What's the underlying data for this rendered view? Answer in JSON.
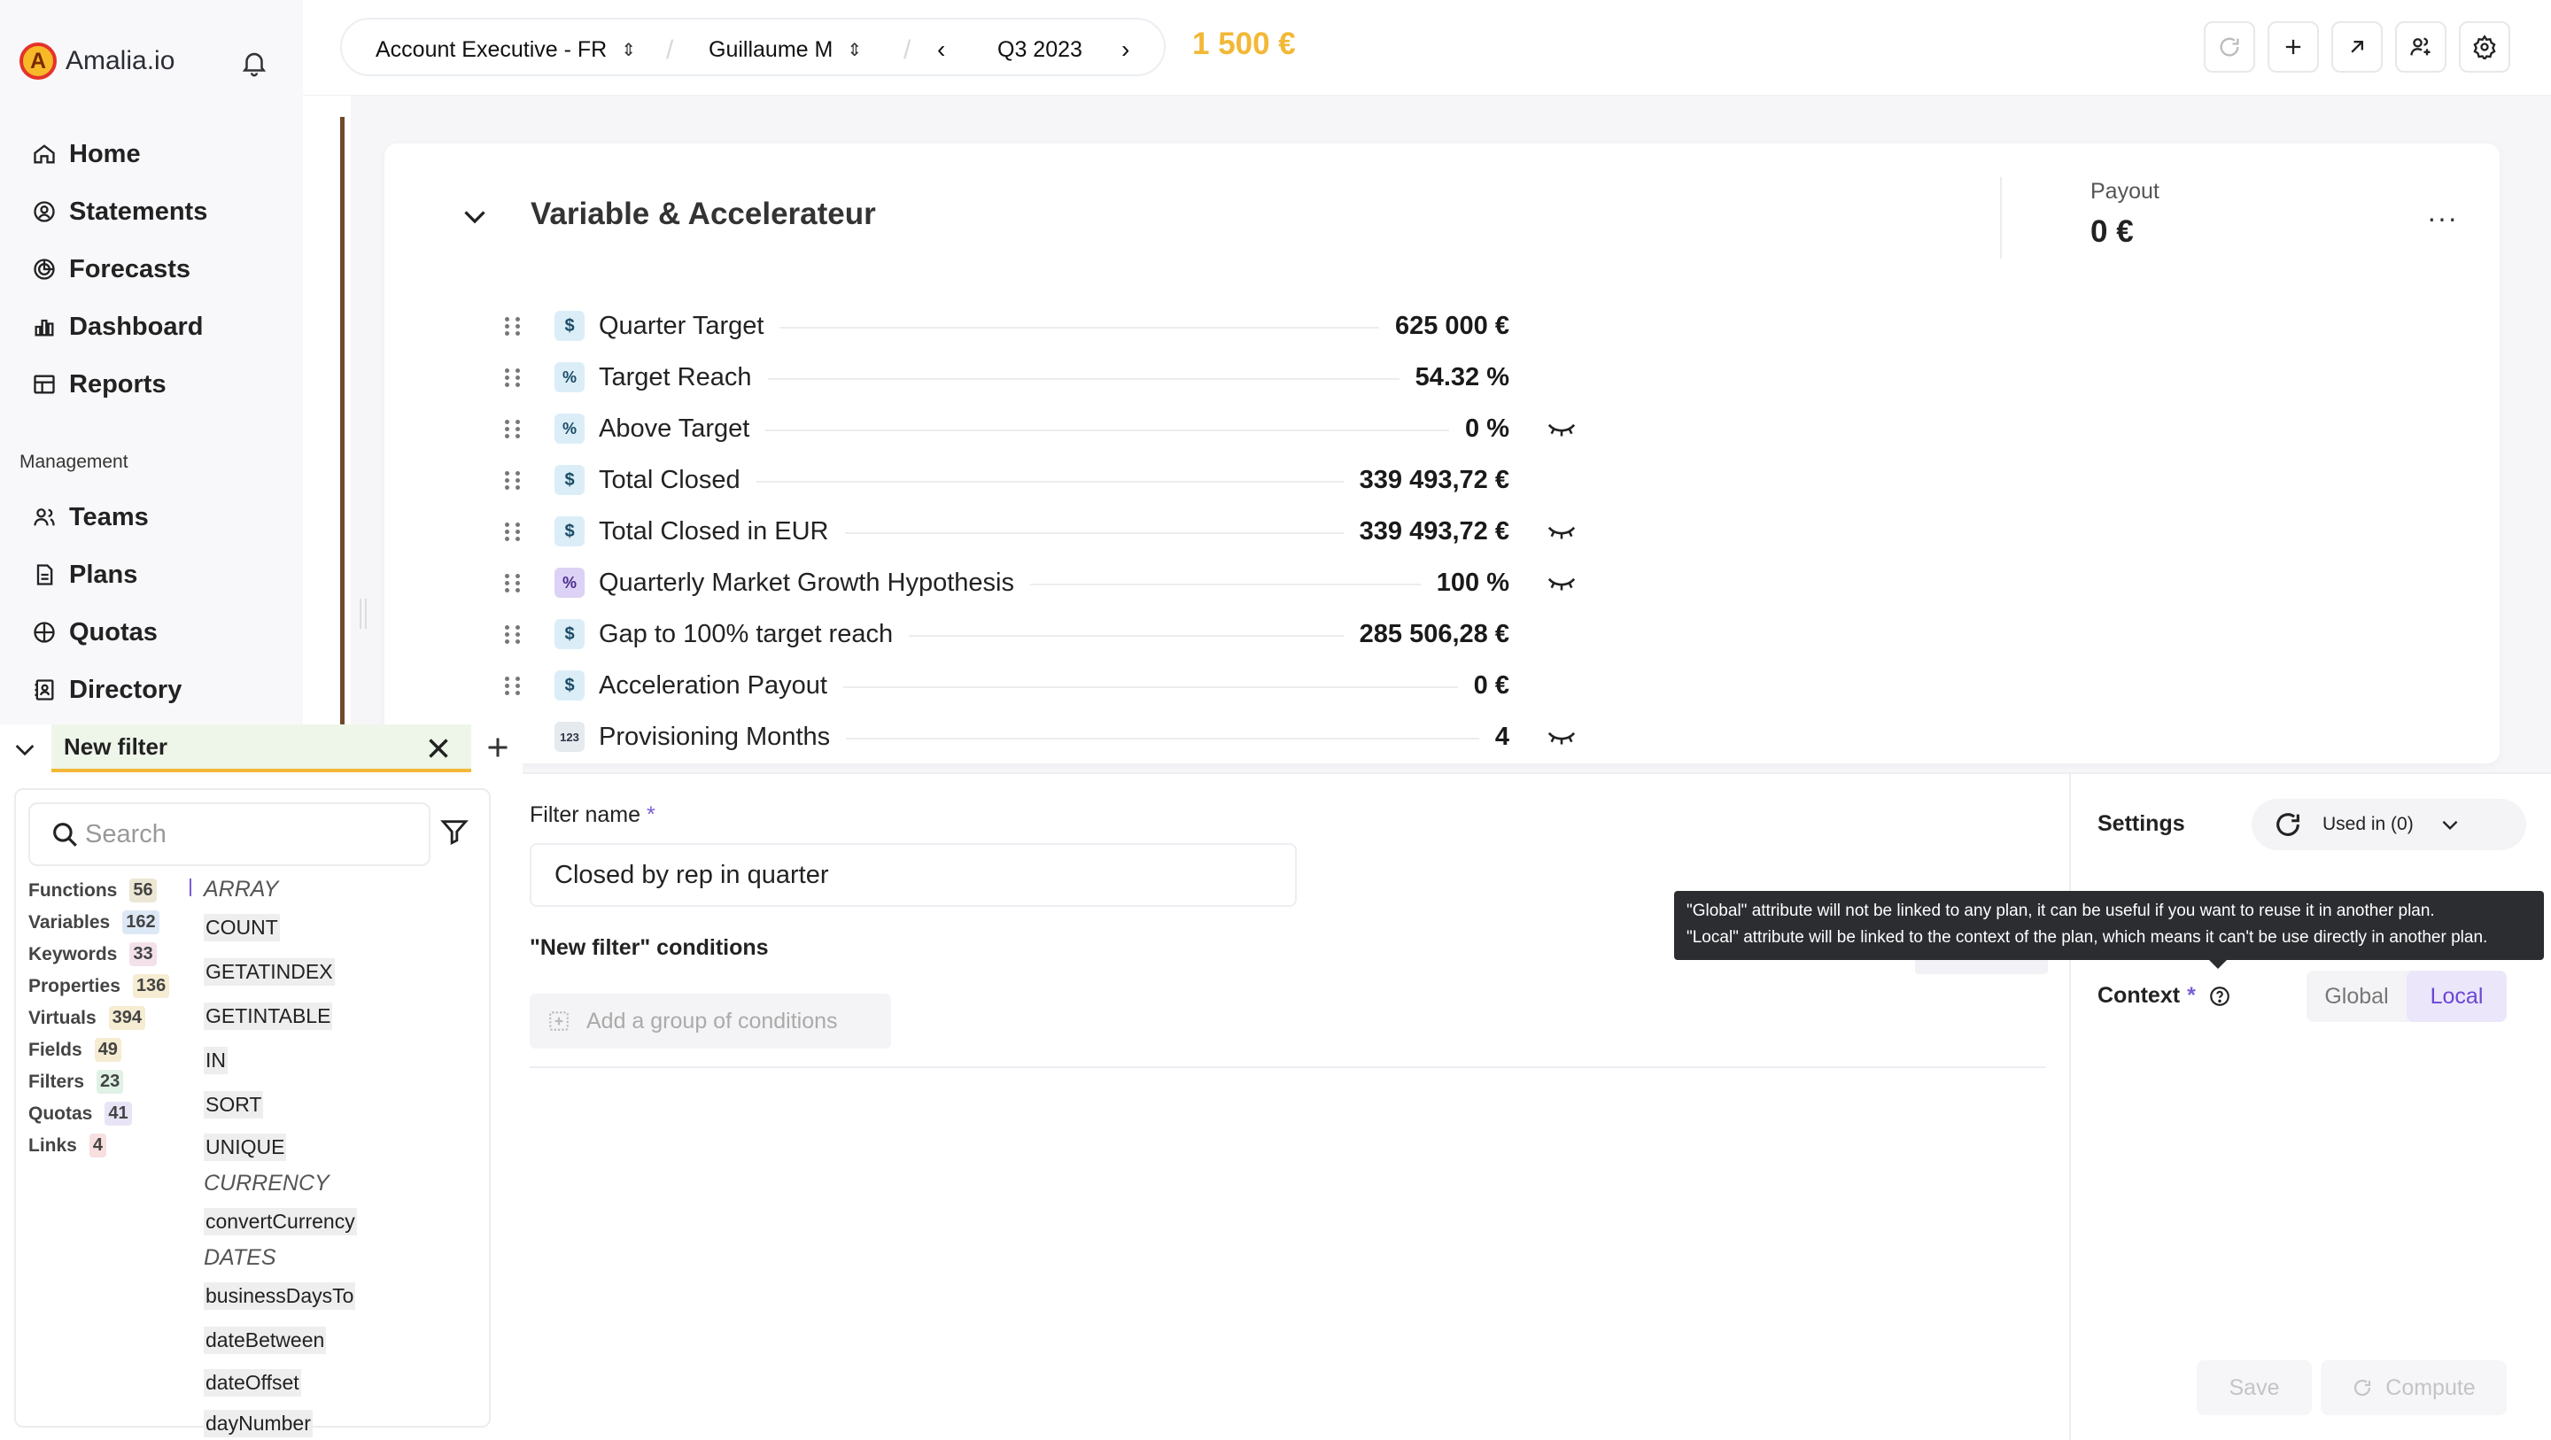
{
  "app": {
    "logo_letter": "A",
    "name": "Amalia.io"
  },
  "sidebar": {
    "items": [
      {
        "label": "Home"
      },
      {
        "label": "Statements"
      },
      {
        "label": "Forecasts"
      },
      {
        "label": "Dashboard"
      },
      {
        "label": "Reports"
      }
    ],
    "management_title": "Management",
    "management_items": [
      {
        "label": "Teams"
      },
      {
        "label": "Plans"
      },
      {
        "label": "Quotas"
      },
      {
        "label": "Directory"
      }
    ]
  },
  "topbar": {
    "plan": "Account Executive - FR",
    "user": "Guillaume M",
    "period": "Q3 2023",
    "amount": "1 500 €"
  },
  "section": {
    "title": "Variable & Accelerateur",
    "payout_label": "Payout",
    "payout_value": "0 €",
    "more": "···"
  },
  "variables": [
    {
      "icon": "$",
      "label": "Quarter Target",
      "value": "625 000 €",
      "hidden": false
    },
    {
      "icon": "%",
      "label": "Target Reach",
      "value": "54.32 %",
      "hidden": false
    },
    {
      "icon": "%",
      "label": "Above Target",
      "value": "0 %",
      "hidden": true
    },
    {
      "icon": "$",
      "label": "Total Closed",
      "value": "339 493,72 €",
      "hidden": false
    },
    {
      "icon": "$",
      "label": "Total Closed in EUR",
      "value": "339 493,72 €",
      "hidden": true
    },
    {
      "icon": "%",
      "label": "Quarterly Market Growth Hypothesis",
      "value": "100 %",
      "hidden": true
    },
    {
      "icon": "$",
      "label": "Gap to 100% target reach",
      "value": "285 506,28 €",
      "hidden": false
    },
    {
      "icon": "$",
      "label": "Acceleration Payout",
      "value": "0 €",
      "hidden": false
    },
    {
      "icon": "123",
      "label": "Provisioning Months",
      "value": "4",
      "hidden": true
    }
  ],
  "filter_tab": {
    "label": "New filter"
  },
  "library": {
    "search_placeholder": "Search",
    "categories": [
      {
        "label": "Functions",
        "count": "56",
        "color": "#ece7d4"
      },
      {
        "label": "Variables",
        "count": "162",
        "color": "#dde8f6"
      },
      {
        "label": "Keywords",
        "count": "33",
        "color": "#f3e1ea"
      },
      {
        "label": "Properties",
        "count": "136",
        "color": "#f6ecd2"
      },
      {
        "label": "Virtuals",
        "count": "394",
        "color": "#f6ecd2"
      },
      {
        "label": "Fields",
        "count": "49",
        "color": "#f6ecd2"
      },
      {
        "label": "Filters",
        "count": "23",
        "color": "#e0f1e6"
      },
      {
        "label": "Quotas",
        "count": "41",
        "color": "#e8e4f6"
      },
      {
        "label": "Links",
        "count": "4",
        "color": "#f7dedf"
      }
    ],
    "functions": [
      {
        "group": "ARRAY"
      },
      {
        "fn": "COUNT"
      },
      {
        "fn": "GETATINDEX"
      },
      {
        "fn": "GETINTABLE"
      },
      {
        "fn": "IN"
      },
      {
        "fn": "SORT"
      },
      {
        "fn": "UNIQUE"
      },
      {
        "group": "CURRENCY"
      },
      {
        "fn": "convertCurrency"
      },
      {
        "group": "DATES"
      },
      {
        "fn": "businessDaysTo"
      },
      {
        "fn": "dateBetween"
      },
      {
        "fn": "dateOffset"
      },
      {
        "fn": "dayNumber"
      }
    ]
  },
  "editor": {
    "filter_name_label": "Filter name",
    "required_mark": "*",
    "filter_name_value": "Closed by rep in quarter",
    "conditions_label": "\"New filter\" conditions",
    "add_group_label": "Add a group of conditions"
  },
  "settings": {
    "title": "Settings",
    "used_in": "Used in (0)",
    "tooltip_line1": "\"Global\" attribute will not be linked to any plan, it can be useful if you want to reuse it in another plan.",
    "tooltip_line2": "\"Local\" attribute will be linked to the context of the plan, which means it can't be use directly in another plan.",
    "context_label": "Context",
    "context_options": [
      "Global",
      "Local"
    ],
    "context_selected": "Local",
    "save_label": "Save",
    "compute_label": "Compute"
  },
  "colors": {
    "accent": "#f2b836",
    "primary": "#7b5cd6",
    "brown_rule": "#6e4a2a"
  }
}
